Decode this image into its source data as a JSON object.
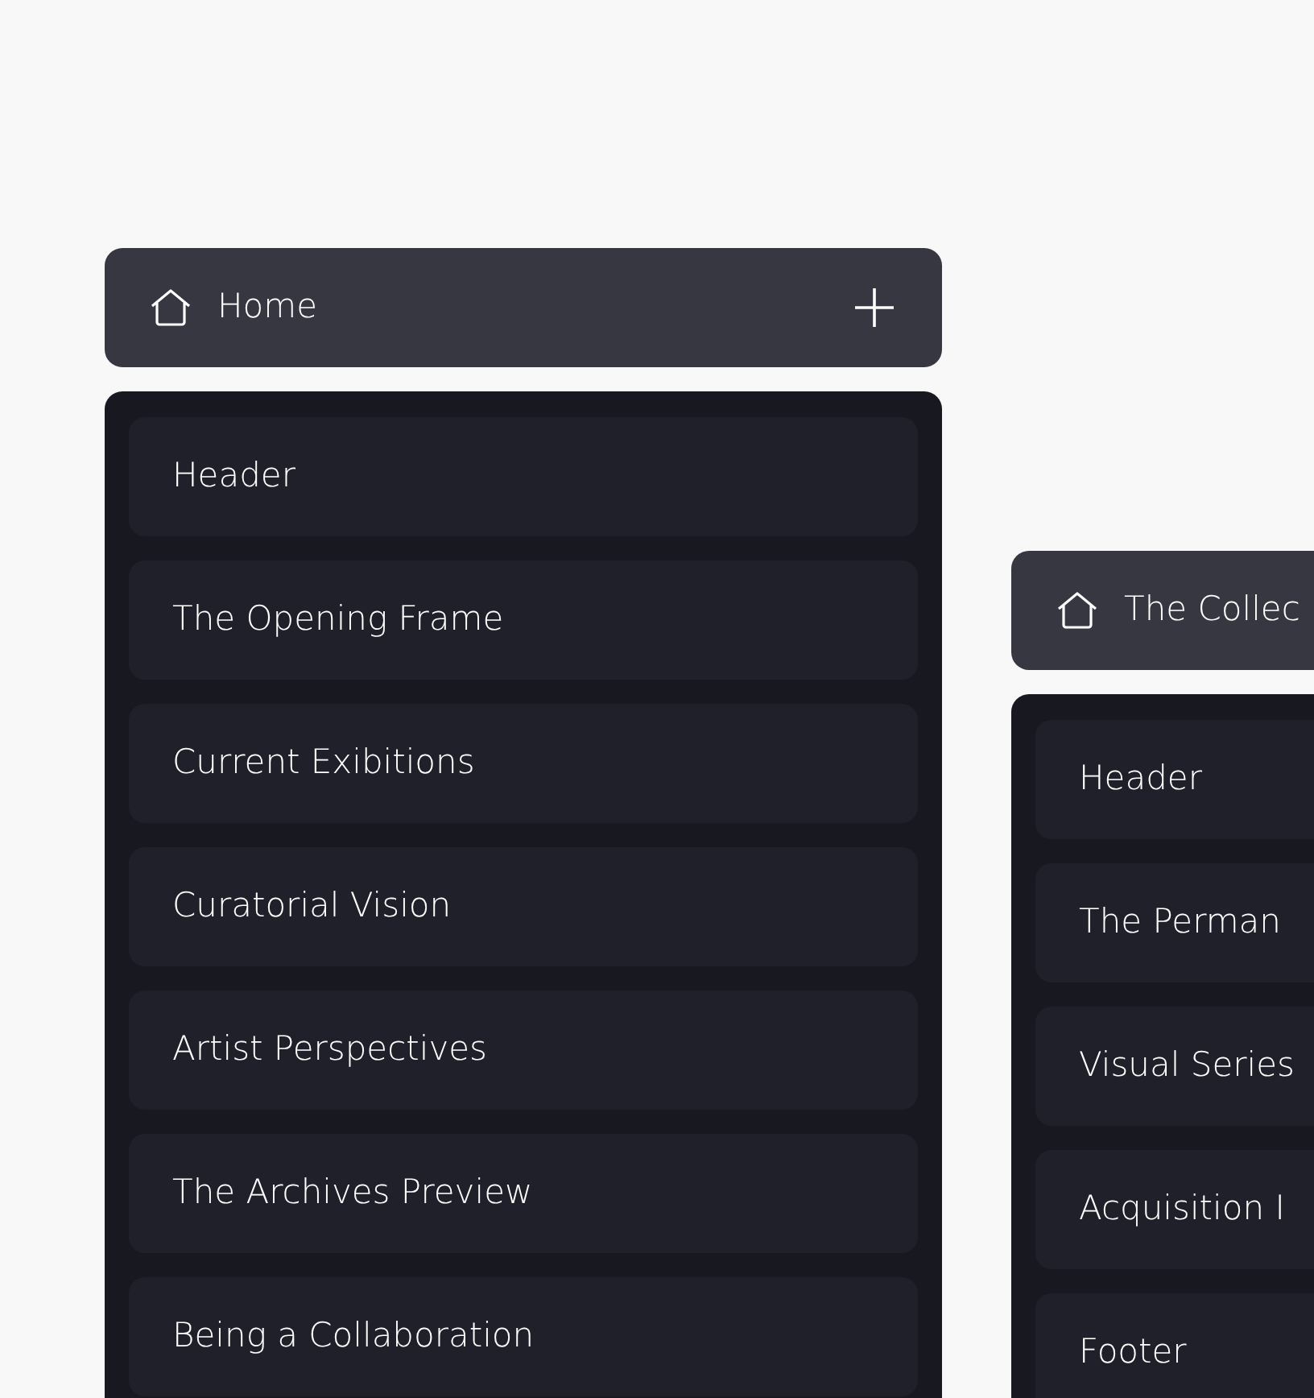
{
  "pages": [
    {
      "title": "Home",
      "add_button": true,
      "sections": [
        "Header",
        "The Opening Frame",
        "Current Exibitions",
        "Curatorial Vision",
        "Artist Perspectives",
        "The Archives Preview",
        "Being a Collaboration"
      ]
    },
    {
      "title": "The Collec",
      "sections": [
        "Header",
        "The Perman",
        "Visual Series",
        "Acquisition I",
        "Footer"
      ]
    }
  ]
}
